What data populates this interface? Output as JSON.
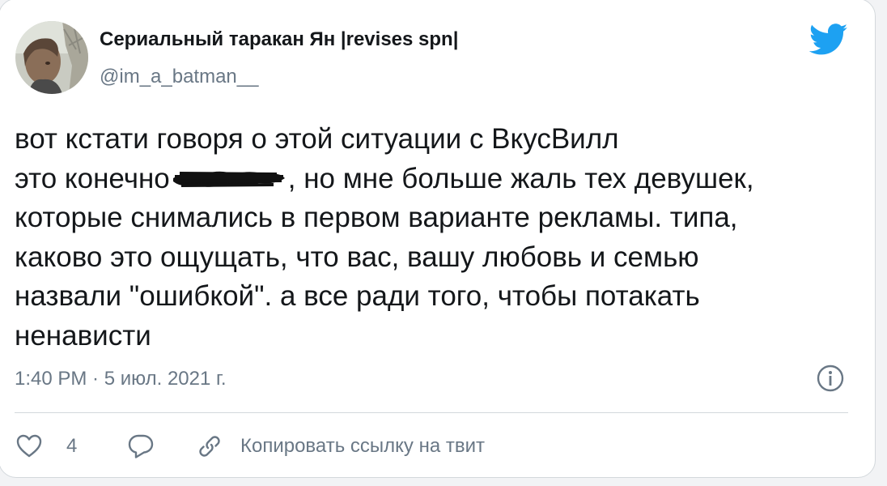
{
  "tweet": {
    "author": {
      "display_name": "Сериальный таракан Ян |revises spn|",
      "handle": "@im_a_batman__"
    },
    "text_lines": [
      "вот кстати говоря о этой ситуации с ВкусВилл",
      "это конечно",
      ", но мне больше жаль тех девушек,",
      "которые снимались в первом варианте рекламы. типа,",
      "каково это ощущать, что вас, вашу любовь и семью",
      "назвали \"ошибкой\". а все ради того, чтобы потакать",
      "ненависти"
    ],
    "timestamp": "1:40 PM · 5 июл. 2021 г.",
    "likes_count": "4",
    "copy_link_label": "Копировать ссылку на твит"
  },
  "colors": {
    "text_primary": "#14171a",
    "text_secondary": "#697785",
    "twitter_blue": "#1da1f2",
    "divider": "#d3d8dc"
  },
  "icons": {
    "brand": "twitter-bird-icon",
    "info": "info-icon",
    "like": "heart-icon",
    "reply": "reply-bubble-icon",
    "copy": "link-icon"
  }
}
